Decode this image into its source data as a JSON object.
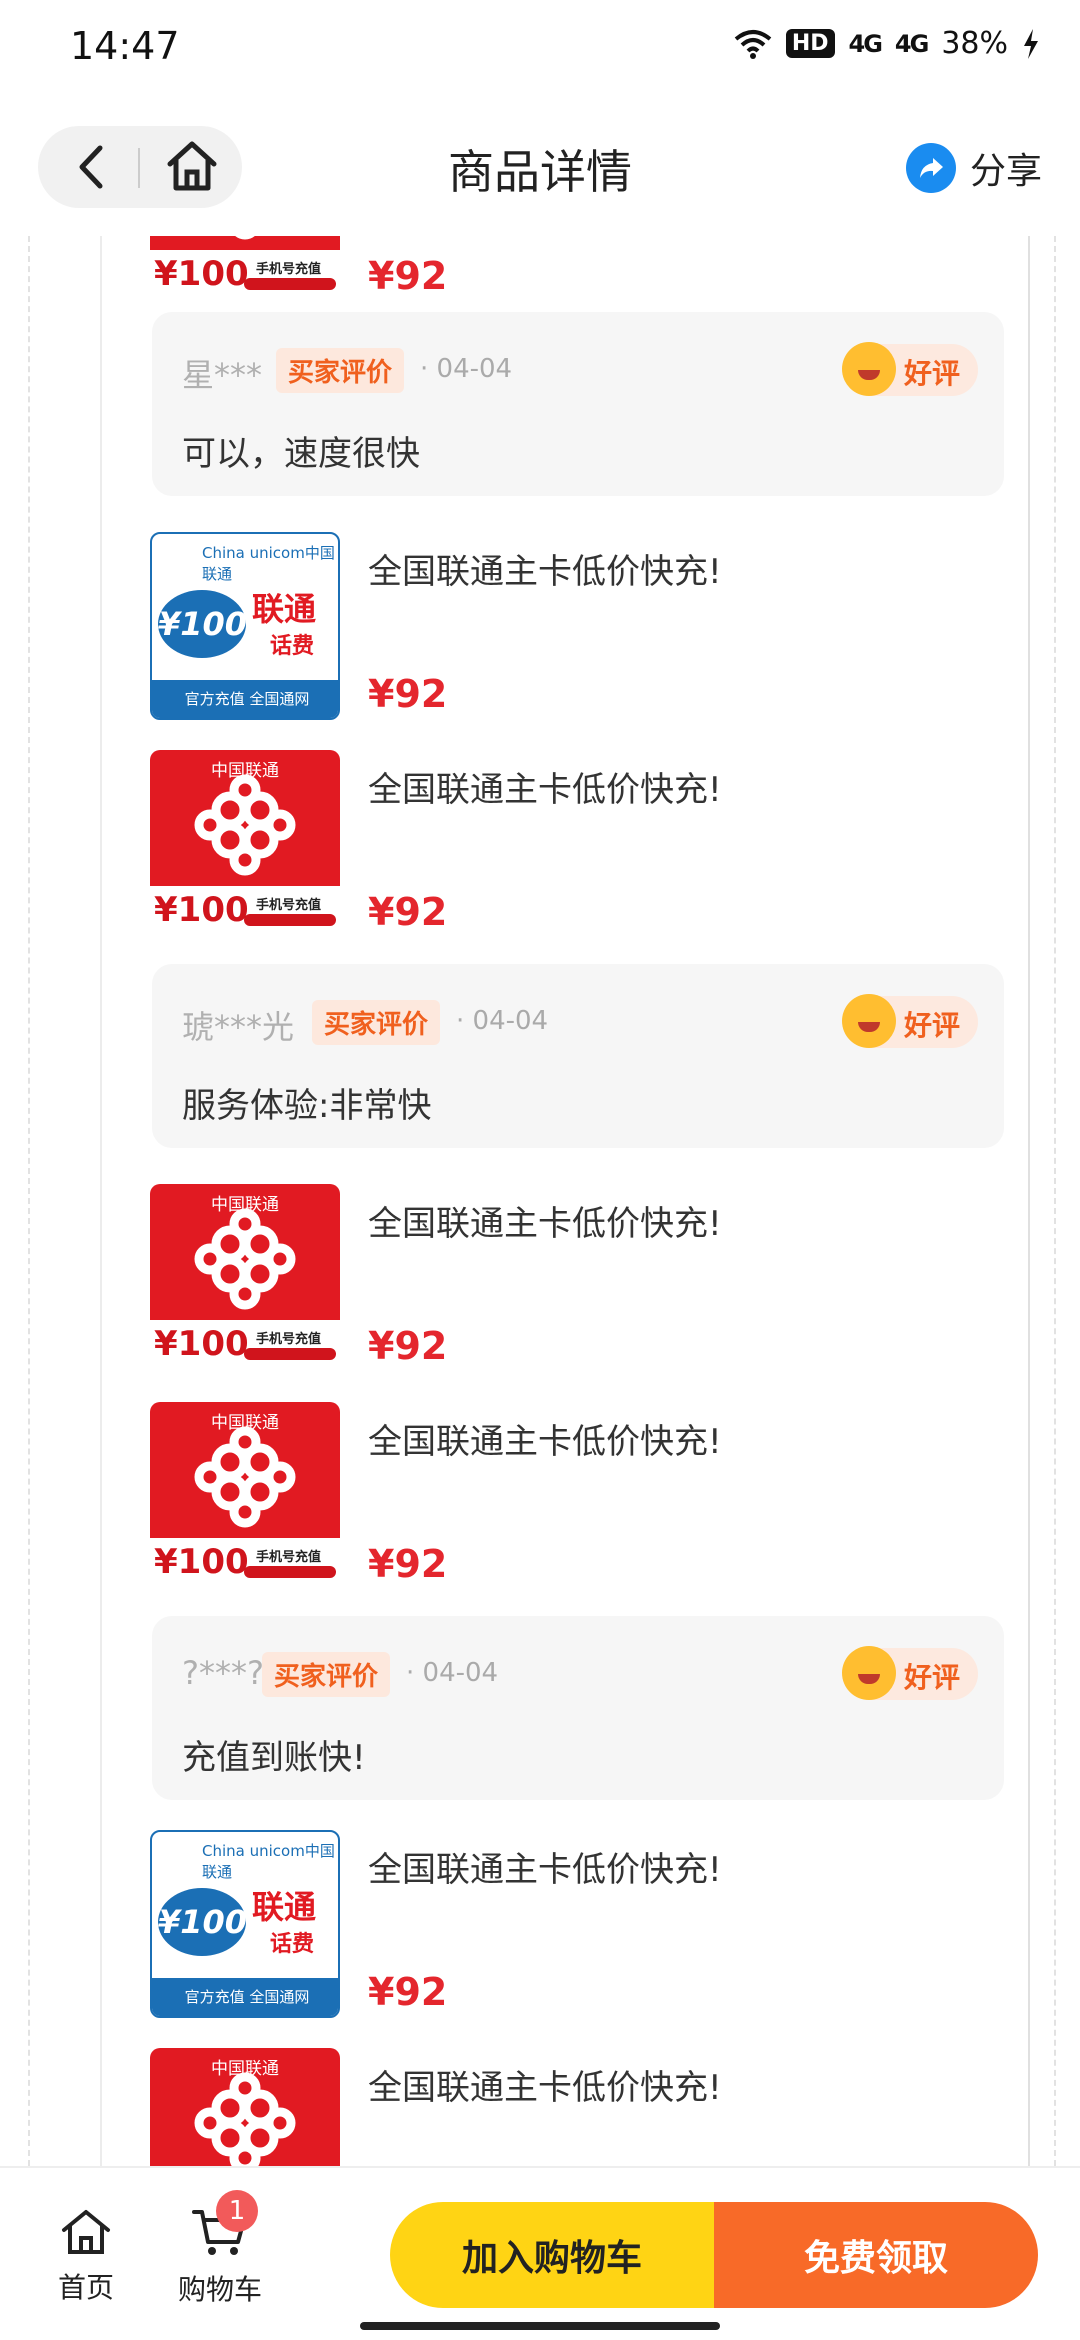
{
  "status": {
    "time": "14:47",
    "hd": "HD",
    "net1": "4G",
    "net2": "4G",
    "battery": "38%"
  },
  "header": {
    "title": "商品详情",
    "share_label": "分享"
  },
  "product": {
    "title": "全国联通主卡低价快充!",
    "price": "¥92",
    "thumb_red": {
      "brand": "中国联通",
      "amount": "¥100",
      "sub": "手机号充值"
    },
    "thumb_blue": {
      "logo": "China unicom中国联通",
      "amount": "¥100",
      "brand": "联通",
      "type": "话费",
      "footer": "官方充值 全国通网"
    }
  },
  "reviews": [
    {
      "user": "星***",
      "tag": "买家评价",
      "date": "· 04-04",
      "rating": "好评",
      "text": "可以，速度很快"
    },
    {
      "user": "琥***光",
      "tag": "买家评价",
      "date": "· 04-04",
      "rating": "好评",
      "text": "服务体验:非常快"
    },
    {
      "user": "?***?",
      "tag": "买家评价",
      "date": "· 04-04",
      "rating": "好评",
      "text": "充值到账快!"
    }
  ],
  "bottom": {
    "home_label": "首页",
    "cart_label": "购物车",
    "cart_badge": "1",
    "add_cart": "加入购物车",
    "free_claim": "免费领取"
  },
  "colors": {
    "price_red": "#e4262d",
    "unicom_red": "#e11a22",
    "unicom_blue": "#1b6fb5",
    "cta_yellow": "#ffd414",
    "cta_orange": "#f86a28",
    "review_tag": "#f0601e"
  }
}
